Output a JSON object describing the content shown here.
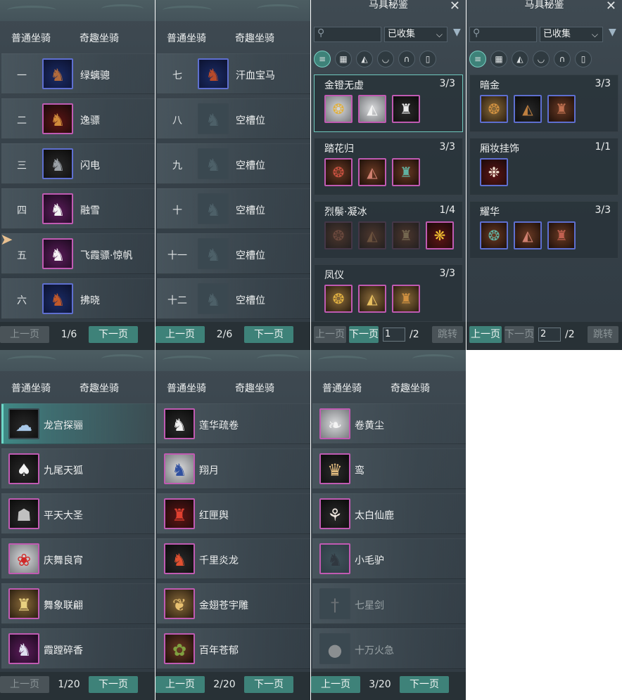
{
  "tabs": {
    "normal": "普通坐骑",
    "special": "奇趣坐骑"
  },
  "pager": {
    "prev": "上一页",
    "next": "下一页"
  },
  "p1": {
    "page": "1/6",
    "rows": [
      {
        "num": "一",
        "name": "绿螭骢"
      },
      {
        "num": "二",
        "name": "逸骠"
      },
      {
        "num": "三",
        "name": "闪电"
      },
      {
        "num": "四",
        "name": "融雪"
      },
      {
        "num": "五",
        "name": "飞霞骠·惊帆"
      },
      {
        "num": "六",
        "name": "拂晓"
      }
    ]
  },
  "p2": {
    "page": "2/6",
    "rows": [
      {
        "num": "七",
        "name": "汗血宝马"
      },
      {
        "num": "八",
        "name": "空槽位"
      },
      {
        "num": "九",
        "name": "空槽位"
      },
      {
        "num": "十",
        "name": "空槽位"
      },
      {
        "num": "十一",
        "name": "空槽位"
      },
      {
        "num": "十二",
        "name": "空槽位"
      }
    ]
  },
  "catalog": {
    "title": "马具秘鉴",
    "filter_value": "已收集",
    "jump": "跳转",
    "c1": {
      "page_value": "1",
      "page_total": "/2",
      "sets": [
        {
          "name": "金镫无虚",
          "count": "3/3"
        },
        {
          "name": "踏花归",
          "count": "3/3"
        },
        {
          "name": "烈鬃·凝冰",
          "count": "1/4"
        },
        {
          "name": "凤仪",
          "count": "3/3"
        }
      ]
    },
    "c2": {
      "page_value": "2",
      "page_total": "/2",
      "sets": [
        {
          "name": "暗金",
          "count": "3/3"
        },
        {
          "name": "厢妆挂饰",
          "count": "1/1"
        },
        {
          "name": "耀华",
          "count": "3/3"
        }
      ]
    }
  },
  "p4": {
    "page": "1/20",
    "rows": [
      {
        "name": "龙宫探骊"
      },
      {
        "name": "九尾天狐"
      },
      {
        "name": "平天大圣"
      },
      {
        "name": "庆舞良宵"
      },
      {
        "name": "舞象联翩"
      },
      {
        "name": "霞蹚碎香"
      }
    ]
  },
  "p5": {
    "page": "2/20",
    "rows": [
      {
        "name": "莲华疏卷"
      },
      {
        "name": "翔月"
      },
      {
        "name": "红匣舆"
      },
      {
        "name": "千里炎龙"
      },
      {
        "name": "金翅苍宇雕"
      },
      {
        "name": "百年苍郁"
      }
    ]
  },
  "p6": {
    "page": "3/20",
    "rows": [
      {
        "name": "卷黄尘"
      },
      {
        "name": "鸾"
      },
      {
        "name": "太白仙鹿"
      },
      {
        "name": "小毛驴"
      },
      {
        "name": "七星剑"
      },
      {
        "name": "十万火急"
      }
    ]
  },
  "icons": {
    "horse": "horse-icon",
    "empty_slot": "empty-slot-icon",
    "search": "search-icon",
    "filter": "filter-icon",
    "close": "close-icon"
  }
}
